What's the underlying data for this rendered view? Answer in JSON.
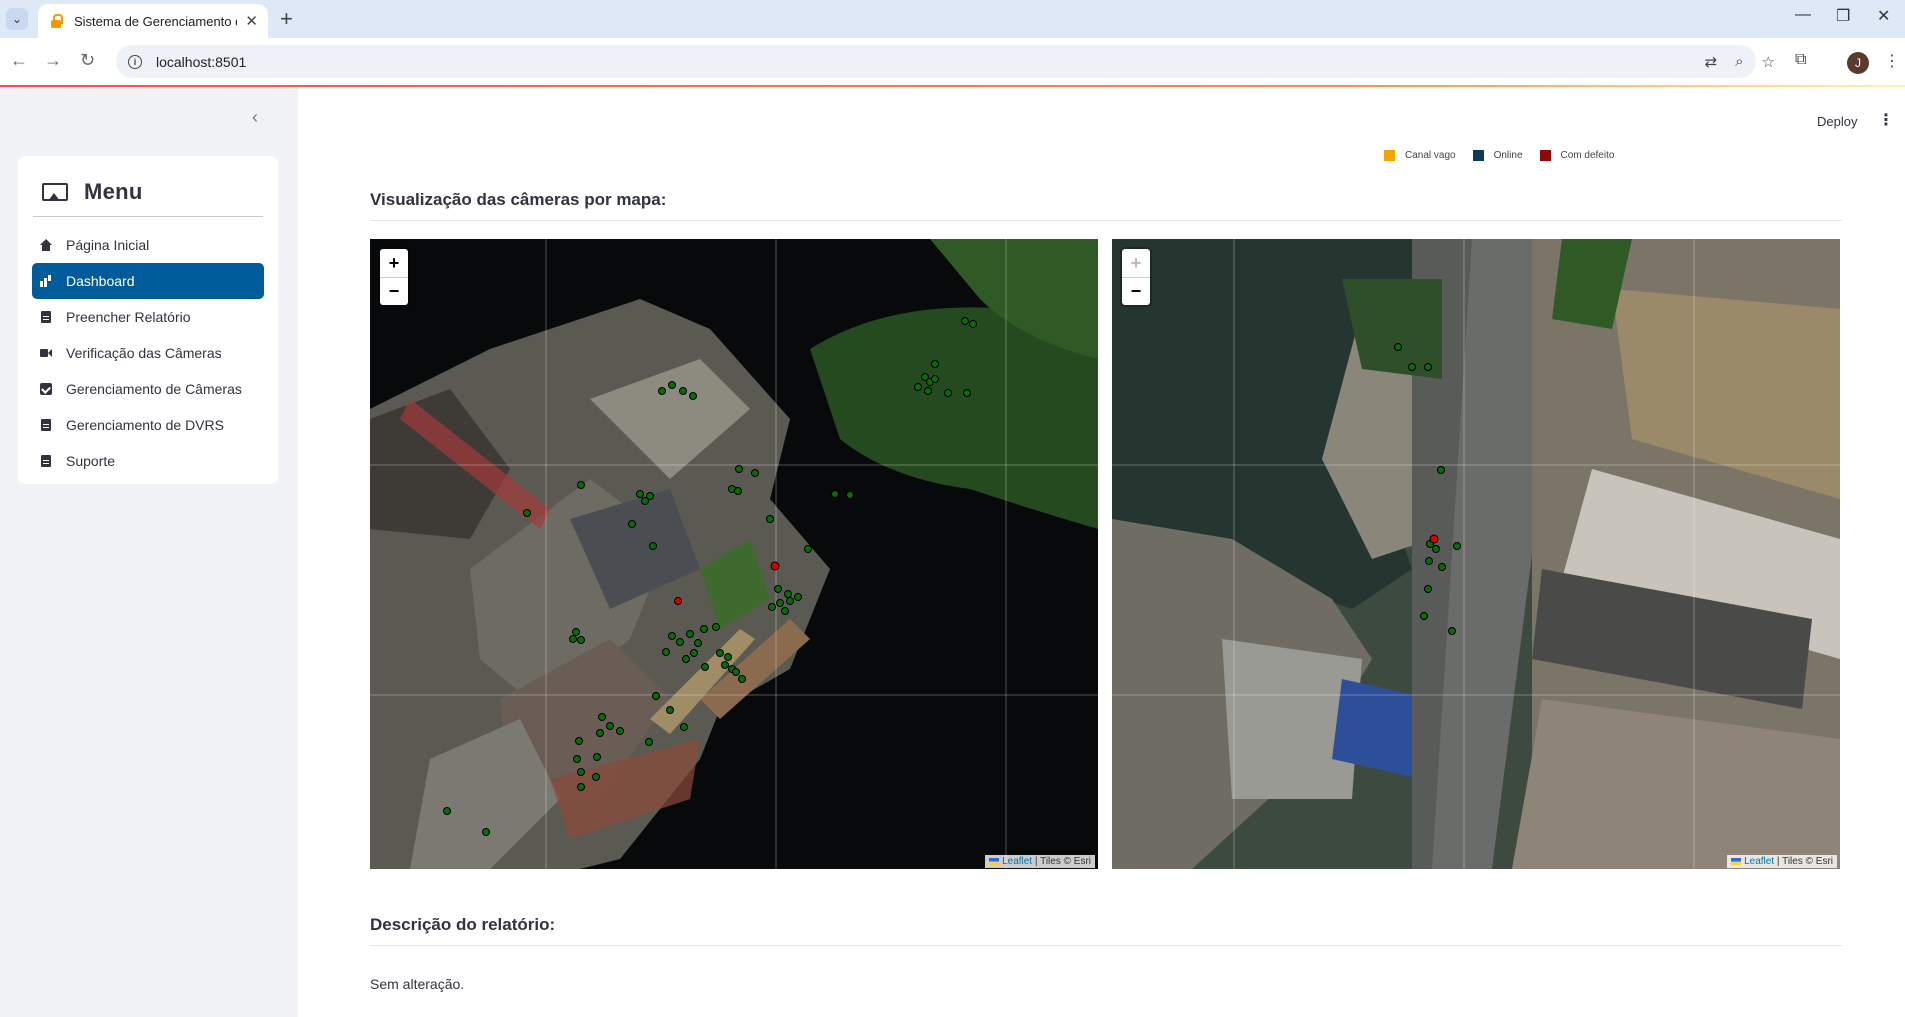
{
  "browser": {
    "tab_title": "Sistema de Gerenciamento de C",
    "url": "localhost:8501",
    "avatar_initial": "J"
  },
  "sidebar": {
    "menu_title": "Menu",
    "items": [
      {
        "label": "Página Inicial",
        "icon": "house-icon",
        "active": false
      },
      {
        "label": "Dashboard",
        "icon": "bar-chart-icon",
        "active": true
      },
      {
        "label": "Preencher Relatório",
        "icon": "file-icon",
        "active": false
      },
      {
        "label": "Verificação das Câmeras",
        "icon": "camera-icon",
        "active": false
      },
      {
        "label": "Gerenciamento de Câmeras",
        "icon": "check-square-icon",
        "active": false
      },
      {
        "label": "Gerenciamento de DVRS",
        "icon": "file-icon",
        "active": false
      },
      {
        "label": "Suporte",
        "icon": "file-icon",
        "active": false
      }
    ]
  },
  "header": {
    "deploy_label": "Deploy"
  },
  "legend": [
    {
      "label": "Canal vago",
      "color": "#f5a300"
    },
    {
      "label": "Online",
      "color": "#0d3b55"
    },
    {
      "label": "Com defeito",
      "color": "#8b0a0a"
    }
  ],
  "maps_section": {
    "title": "Visualização das câmeras por mapa:",
    "zoom_in": "+",
    "zoom_out": "−",
    "attribution_link": "Leaflet",
    "attribution_text": "| Tiles © Esri"
  },
  "report_section": {
    "title": "Descrição do relatório:",
    "text": "Sem alteração."
  },
  "colors": {
    "accent": "#005b9a",
    "marker_online": "#0a6b0a",
    "marker_defect": "#d40000"
  }
}
